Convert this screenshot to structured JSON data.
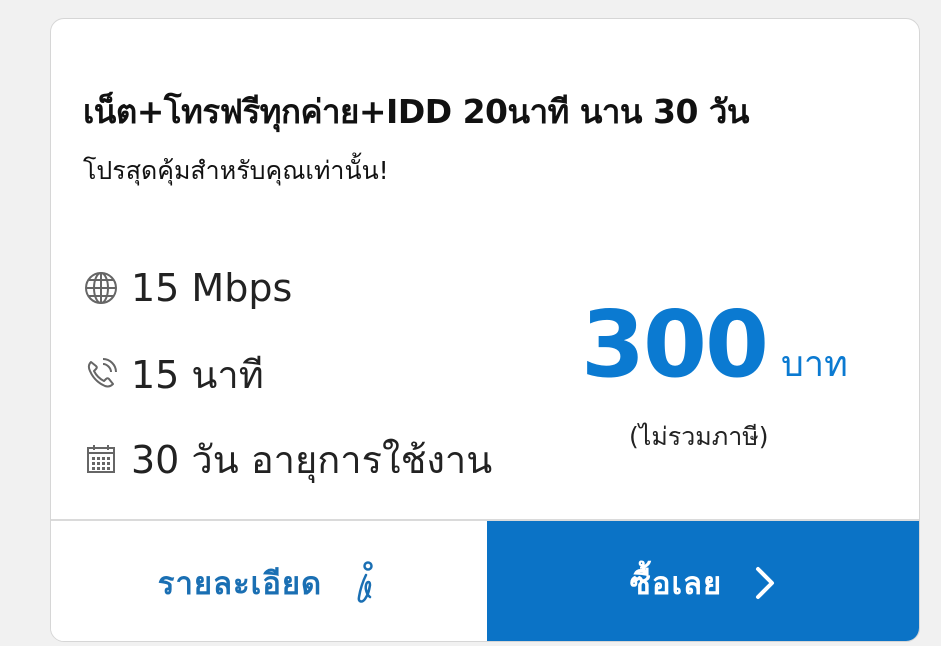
{
  "package": {
    "title": "เน็ต+โทรฟรีทุกค่าย+IDD 20นาที นาน 30 วัน",
    "subtitle": "โปรสุดคุ้มสำหรับคุณเท่านั้น!"
  },
  "features": [
    {
      "icon": "globe-icon",
      "text": "15 Mbps"
    },
    {
      "icon": "phone-icon",
      "text": "15 นาที"
    },
    {
      "icon": "calendar-icon",
      "text": "30 วัน อายุการใช้งาน"
    }
  ],
  "price": {
    "amount": "300",
    "currency": "บาท",
    "tax_note": "(ไม่รวมภาษี)"
  },
  "actions": {
    "details_label": "รายละเอียด",
    "details_icon": "info-icon",
    "buy_label": "ซื้อเลย",
    "buy_icon": "chevron-right-icon"
  },
  "colors": {
    "accent": "#0b7ad1",
    "buy_button_bg": "#0b73c6",
    "details_text": "#1a6fb3"
  }
}
